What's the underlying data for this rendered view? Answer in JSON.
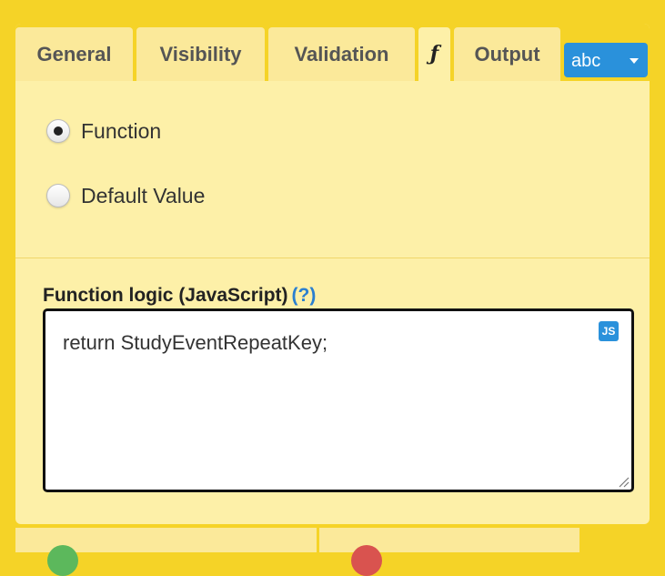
{
  "tabs": [
    {
      "label": "General"
    },
    {
      "label": "Visibility"
    },
    {
      "label": "Validation"
    },
    {
      "label": "ƒ"
    },
    {
      "label": "Output"
    }
  ],
  "type_button": {
    "label": "abc"
  },
  "options": {
    "function_label": "Function",
    "default_value_label": "Default Value",
    "selected": "Function"
  },
  "function_logic": {
    "label": "Function logic (JavaScript)",
    "help": "(?)",
    "code": "return StudyEventRepeatKey;",
    "js_icon": "JS"
  },
  "colors": {
    "background": "#f5d327",
    "panel": "#fdf0a8",
    "accent": "#2a91db",
    "save": "#5cb85c",
    "cancel": "#d9534f"
  }
}
